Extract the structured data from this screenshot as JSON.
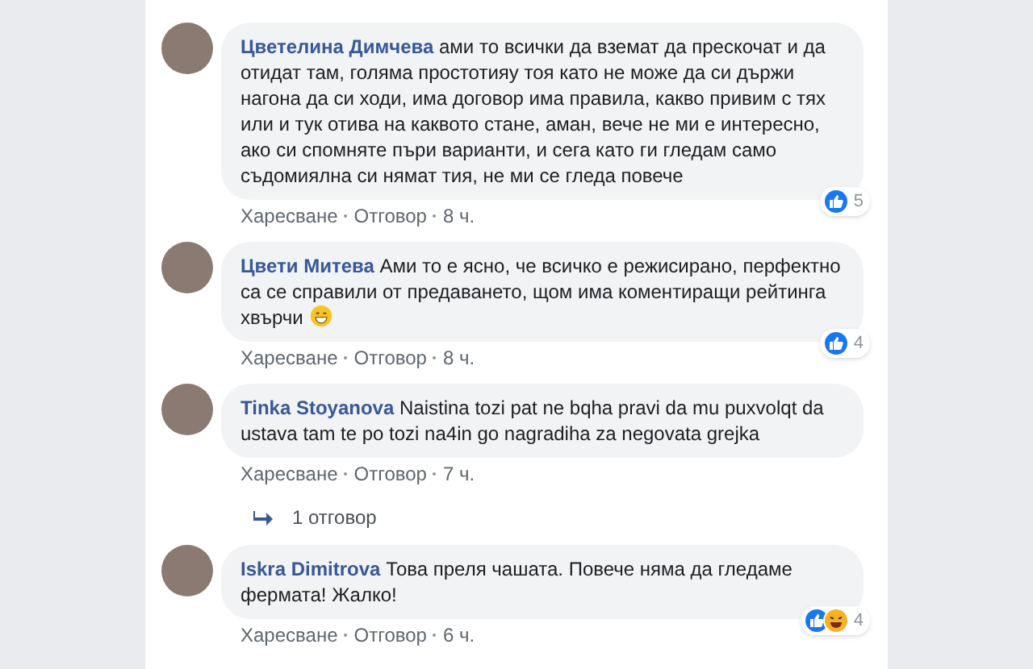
{
  "comments": [
    {
      "author": "Цветелина Димчева",
      "text": "ами то всички да вземат да прескочат и да отидат там, голяма простотияу тоя като не може да си държи нагона да си ходи, има договор има правила, какво привим с тях или и тук отива на каквото стане, аман, вече не ми е интересно, ако си спомняте пъри варианти, и сега като ги гледам само съдомиялна си нямат тия, не ми се гледа повече",
      "emoji": false,
      "reactions": [
        {
          "kind": "like"
        }
      ],
      "reaction_count": "5",
      "actions": [
        "Харесване",
        "Отговор",
        "8 ч."
      ]
    },
    {
      "author": "Цвети Митева",
      "text": "Ами то е ясно, че всичко е режисирано, перфектно са се справили от предаването, щом има коментиращи рейтинга хвърчи",
      "emoji": true,
      "reactions": [
        {
          "kind": "like"
        }
      ],
      "reaction_count": "4",
      "actions": [
        "Харесване",
        "Отговор",
        "8 ч."
      ]
    },
    {
      "author": "Tinka Stoyanova",
      "text": "Naistina tozi pat ne bqha pravi da mu puxvolqt da ustava tam te po tozi na4in go nagradiha za negovata grejka",
      "emoji": false,
      "actions": [
        "Харесване",
        "Отговор",
        "7 ч."
      ],
      "replies": "1 отговор"
    },
    {
      "author": "Iskra Dimitrova",
      "text": "Това преля чашата. Повече няма да гледаме фермата! Жалко!",
      "emoji": false,
      "reactions": [
        {
          "kind": "like"
        },
        {
          "kind": "haha"
        }
      ],
      "reaction_count": "4",
      "actions": [
        "Харесване",
        "Отговор",
        "6 ч."
      ]
    }
  ]
}
